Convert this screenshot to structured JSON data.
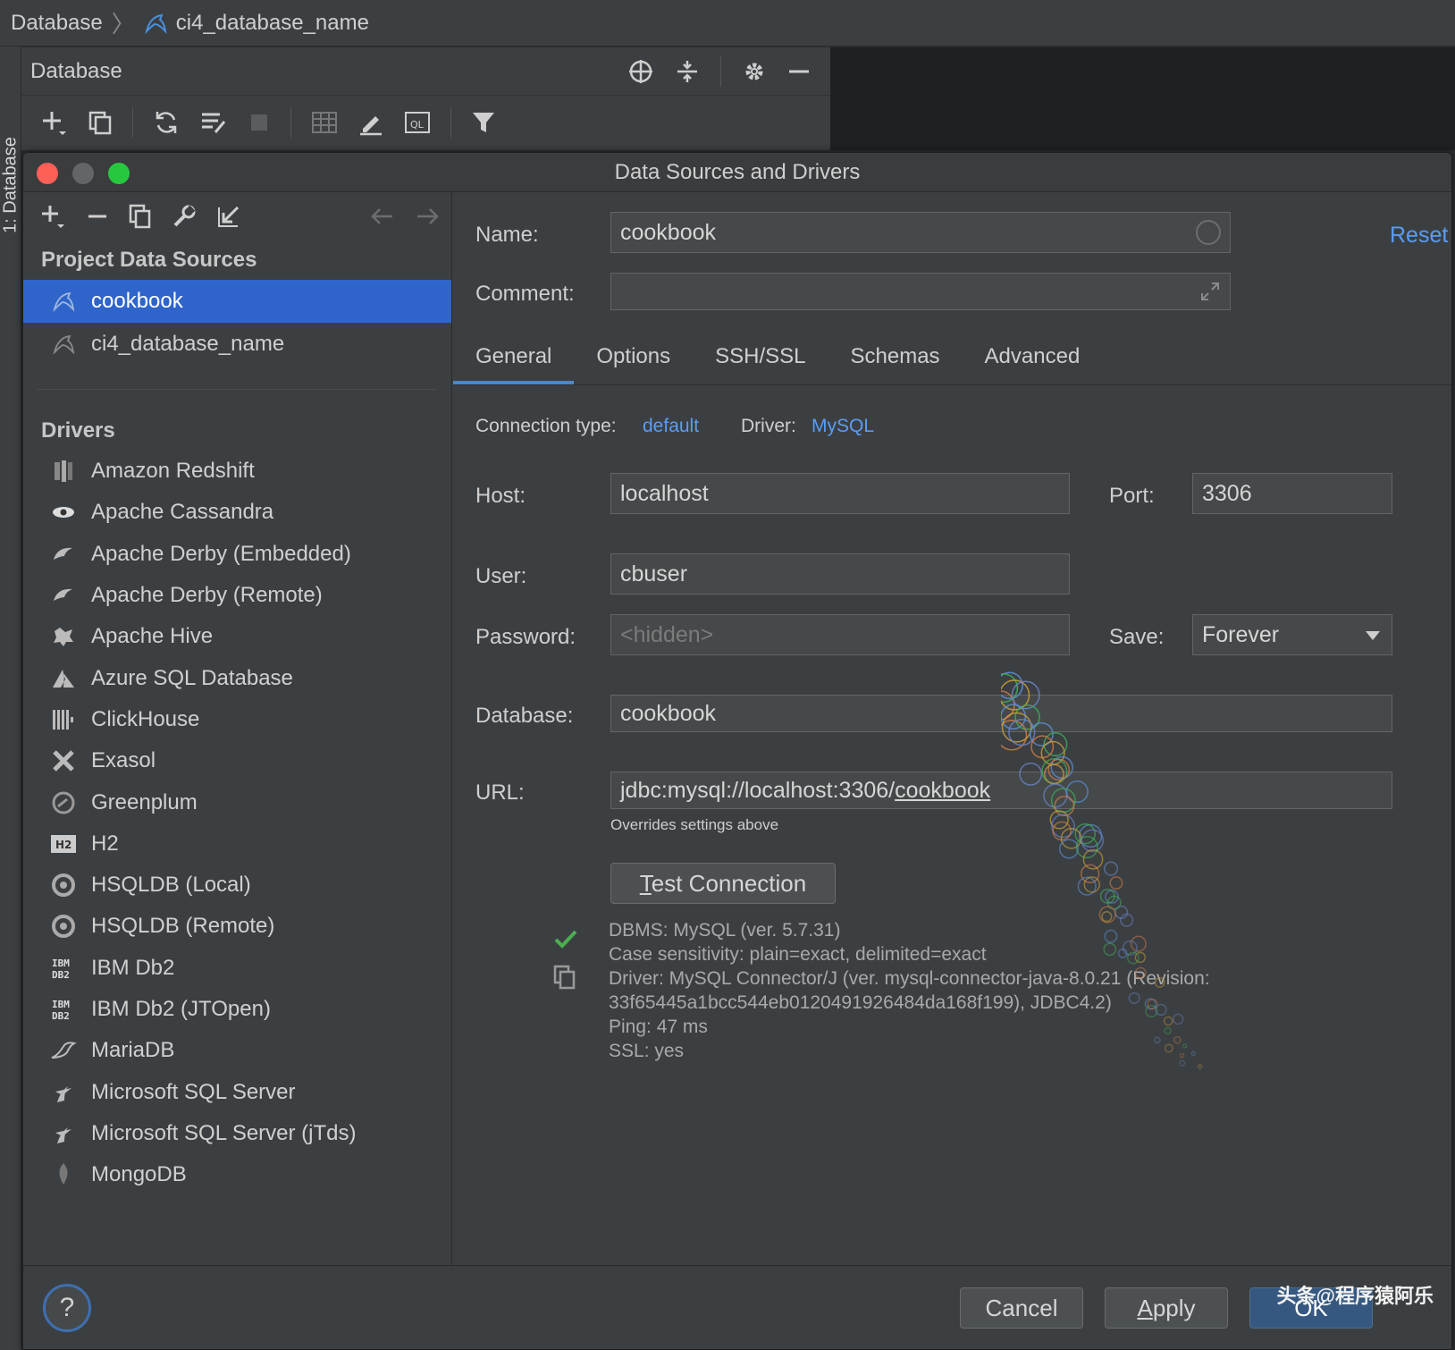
{
  "breadcrumb": {
    "root": "Database",
    "current": "ci4_database_name"
  },
  "side_tab": {
    "label": "1: Database"
  },
  "db_panel": {
    "title": "Database"
  },
  "dialog": {
    "title": "Data Sources and Drivers",
    "left": {
      "project_heading": "Project Data Sources",
      "data_sources": [
        {
          "label": "cookbook",
          "selected": true
        },
        {
          "label": "ci4_database_name",
          "selected": false
        }
      ],
      "drivers_heading": "Drivers",
      "drivers": [
        {
          "label": "Amazon Redshift",
          "icon": "redshift-icon"
        },
        {
          "label": "Apache Cassandra",
          "icon": "cassandra-icon"
        },
        {
          "label": "Apache Derby (Embedded)",
          "icon": "derby-icon"
        },
        {
          "label": "Apache Derby (Remote)",
          "icon": "derby-icon"
        },
        {
          "label": "Apache Hive",
          "icon": "hive-icon"
        },
        {
          "label": "Azure SQL Database",
          "icon": "azure-icon"
        },
        {
          "label": "ClickHouse",
          "icon": "clickhouse-icon"
        },
        {
          "label": "Exasol",
          "icon": "exasol-icon"
        },
        {
          "label": "Greenplum",
          "icon": "greenplum-icon"
        },
        {
          "label": "H2",
          "icon": "h2-icon"
        },
        {
          "label": "HSQLDB (Local)",
          "icon": "hsqldb-icon"
        },
        {
          "label": "HSQLDB (Remote)",
          "icon": "hsqldb-icon"
        },
        {
          "label": "IBM Db2",
          "icon": "ibm-db2-icon"
        },
        {
          "label": "IBM Db2 (JTOpen)",
          "icon": "ibm-db2-icon"
        },
        {
          "label": "MariaDB",
          "icon": "mariadb-icon"
        },
        {
          "label": "Microsoft SQL Server",
          "icon": "mssql-icon"
        },
        {
          "label": "Microsoft SQL Server (jTds)",
          "icon": "mssql-icon"
        },
        {
          "label": "MongoDB",
          "icon": "mongodb-icon"
        }
      ]
    },
    "form": {
      "name_label": "Name:",
      "name_value": "cookbook",
      "reset": "Reset",
      "comment_label": "Comment:",
      "comment_value": "",
      "tabs": [
        "General",
        "Options",
        "SSH/SSL",
        "Schemas",
        "Advanced"
      ],
      "active_tab": "General",
      "connection_type_label": "Connection type:",
      "connection_type_value": "default",
      "driver_label": "Driver:",
      "driver_value": "MySQL",
      "host_label": "Host:",
      "host_value": "localhost",
      "port_label": "Port:",
      "port_value": "3306",
      "user_label": "User:",
      "user_value": "cbuser",
      "password_label": "Password:",
      "password_placeholder": "<hidden>",
      "save_label": "Save:",
      "save_value": "Forever",
      "database_label": "Database:",
      "database_value": "cookbook",
      "url_label": "URL:",
      "url_prefix": "jdbc:mysql://localhost:3306/",
      "url_db": "cookbook",
      "url_hint": "Overrides settings above",
      "test_connection_rest": "est Connection",
      "test_connection_mnemonic": "T"
    },
    "test_result": [
      "DBMS: MySQL (ver. 5.7.31)",
      "Case sensitivity: plain=exact, delimited=exact",
      "Driver: MySQL Connector/J (ver. mysql-connector-java-8.0.21 (Revision:",
      "33f65445a1bcc544eb0120491926484da168f199), JDBC4.2)",
      "Ping: 47 ms",
      "SSL: yes"
    ],
    "footer": {
      "help": "?",
      "cancel": "Cancel",
      "apply_mnemonic": "A",
      "apply_rest": "pply",
      "ok": "OK",
      "watermark": "头条@程序猿阿乐"
    }
  },
  "colors": {
    "selection": "#2f65ca",
    "link": "#589df6",
    "ok_button": "#365880",
    "success_check": "#4caf50"
  }
}
